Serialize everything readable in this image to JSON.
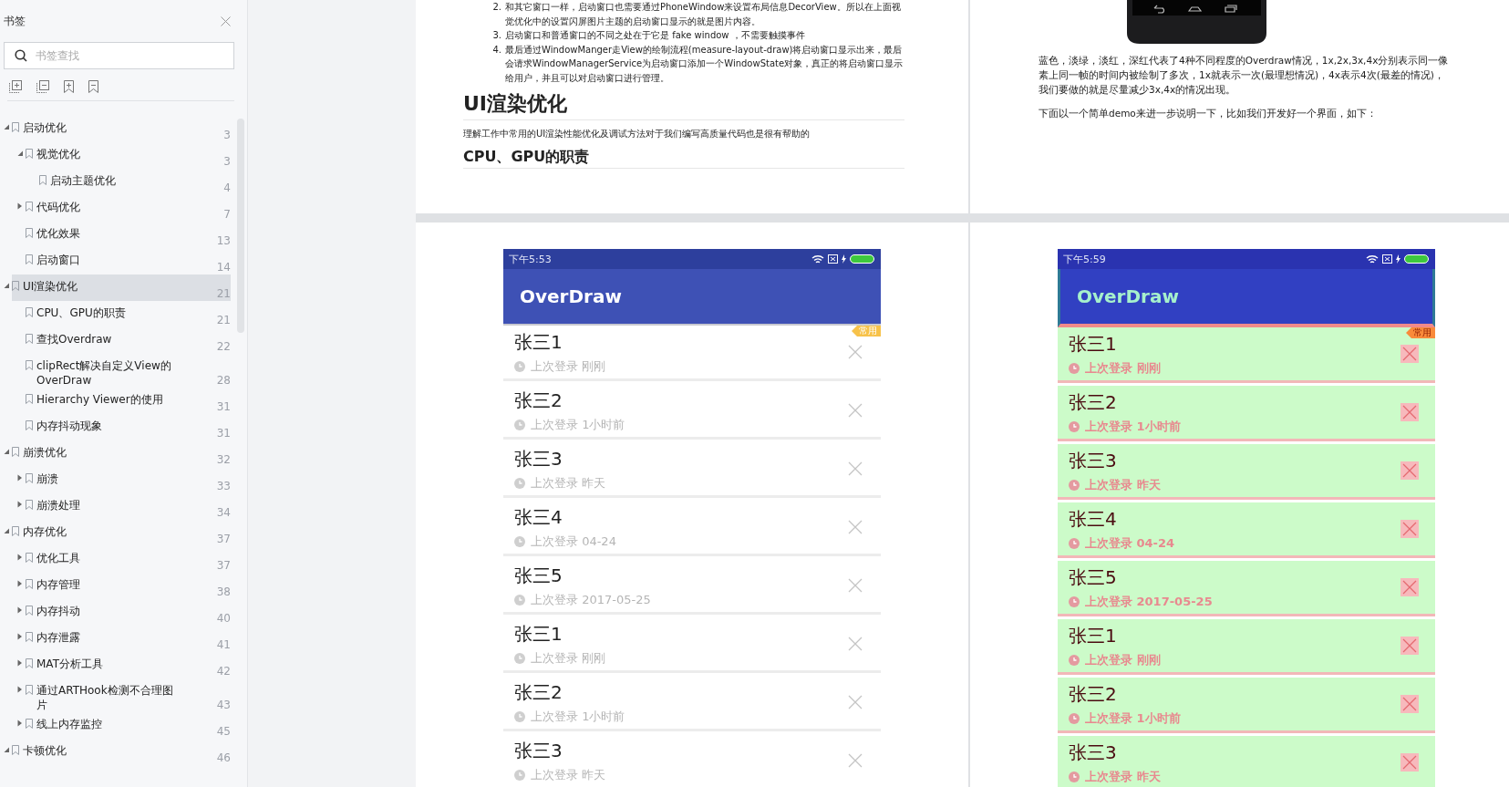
{
  "sidebar": {
    "title": "书签",
    "search": {
      "placeholder": "书签查找"
    },
    "items": [
      {
        "label": "启动优化",
        "page": "3",
        "selected": false,
        "expanded": true,
        "children": [
          {
            "label": "视觉优化",
            "page": "3",
            "selected": false,
            "expanded": true,
            "children": [
              {
                "label": "启动主题优化",
                "page": "4",
                "selected": false
              }
            ]
          },
          {
            "label": "代码优化",
            "page": "7",
            "selected": false,
            "expanded": false
          },
          {
            "label": "优化效果",
            "page": "13",
            "selected": false
          },
          {
            "label": "启动窗口",
            "page": "14",
            "selected": false
          }
        ]
      },
      {
        "label": "UI渲染优化",
        "page": "21",
        "selected": true,
        "expanded": true,
        "children": [
          {
            "label": "CPU、GPU的职责",
            "page": "21",
            "selected": false
          },
          {
            "label": "查找Overdraw",
            "page": "22",
            "selected": false
          },
          {
            "label": "clipRect解决自定义View的OverDraw",
            "page": "28",
            "selected": false
          },
          {
            "label": "Hierarchy Viewer的使用",
            "page": "31",
            "selected": false
          },
          {
            "label": "内存抖动现象",
            "page": "31",
            "selected": false
          }
        ]
      },
      {
        "label": "崩溃优化",
        "page": "32",
        "selected": false,
        "expanded": true,
        "children": [
          {
            "label": "崩溃",
            "page": "33",
            "selected": false,
            "expanded": false
          },
          {
            "label": "崩溃处理",
            "page": "34",
            "selected": false,
            "expanded": false
          }
        ]
      },
      {
        "label": "内存优化",
        "page": "37",
        "selected": false,
        "expanded": true,
        "children": [
          {
            "label": "优化工具",
            "page": "37",
            "selected": false,
            "expanded": false
          },
          {
            "label": "内存管理",
            "page": "38",
            "selected": false,
            "expanded": false
          },
          {
            "label": "内存抖动",
            "page": "40",
            "selected": false,
            "expanded": false
          },
          {
            "label": "内存泄露",
            "page": "41",
            "selected": false,
            "expanded": false
          },
          {
            "label": "MAT分析工具",
            "page": "42",
            "selected": false,
            "expanded": false
          },
          {
            "label": "通过ARTHook检测不合理图片",
            "page": "43",
            "selected": false,
            "expanded": false
          },
          {
            "label": "线上内存监控",
            "page": "45",
            "selected": false,
            "expanded": false
          }
        ]
      },
      {
        "label": "卡顿优化",
        "page": "46",
        "selected": false,
        "expanded": true
      }
    ]
  },
  "page_top_left": {
    "list": [
      {
        "number": "2.",
        "text": "和其它窗口一样，启动窗口也需要通过PhoneWindow来设置布局信息DecorView。所以在上面视觉优化中的设置闪屏图片主题的启动窗口显示的就是图片内容。"
      },
      {
        "number": "3.",
        "text": "启动窗口和普通窗口的不同之处在于它是 fake window ，不需要触摸事件"
      },
      {
        "number": "4.",
        "text": "最后通过WindowManger走View的绘制流程(measure-layout-draw)将启动窗口显示出来，最后会请求WindowManagerService为启动窗口添加一个WindowState对象，真正的将启动窗口显示给用户，并且可以对启动窗口进行管理。"
      }
    ],
    "heading": "UI渲染优化",
    "paragraph": "理解工作中常用的UI渲染性能优化及调试方法对于我们编写高质量代码也是很有帮助的",
    "subheading": "CPU、GPU的职责"
  },
  "page_top_right": {
    "paragraphs": [
      "蓝色，淡绿，淡红，深红代表了4种不同程度的Overdraw情况，1x,2x,3x,4x分别表示同一像素上同一帧的时间内被绘制了多次，1x就表示一次(最理想情况)，4x表示4次(最差的情况)，我们要做的就是尽量减少3x,4x的情况出现。",
      "下面以一个简单demo来进一步说明一下，比如我们开发好一个界面，如下："
    ]
  },
  "phones": [
    {
      "kind": "normal",
      "time": "下午5:53",
      "title": "OverDraw",
      "tag": "常用",
      "rows": [
        {
          "name": "张三1",
          "status": "上次登录 刚刚"
        },
        {
          "name": "张三2",
          "status": "上次登录 1小时前"
        },
        {
          "name": "张三3",
          "status": "上次登录 昨天"
        },
        {
          "name": "张三4",
          "status": "上次登录 04-24"
        },
        {
          "name": "张三5",
          "status": "上次登录 2017-05-25"
        },
        {
          "name": "张三1",
          "status": "上次登录 刚刚"
        },
        {
          "name": "张三2",
          "status": "上次登录 1小时前"
        },
        {
          "name": "张三3",
          "status": "上次登录 昨天"
        }
      ]
    },
    {
      "kind": "overdraw",
      "time": "下午5:59",
      "title": "OverDraw",
      "tag": "常用",
      "rows": [
        {
          "name": "张三1",
          "status": "上次登录 刚刚"
        },
        {
          "name": "张三2",
          "status": "上次登录 1小时前"
        },
        {
          "name": "张三3",
          "status": "上次登录 昨天"
        },
        {
          "name": "张三4",
          "status": "上次登录 04-24"
        },
        {
          "name": "张三5",
          "status": "上次登录 2017-05-25"
        },
        {
          "name": "张三1",
          "status": "上次登录 刚刚"
        },
        {
          "name": "张三2",
          "status": "上次登录 1小时前"
        },
        {
          "name": "张三3",
          "status": "上次登录 昨天"
        }
      ]
    }
  ]
}
